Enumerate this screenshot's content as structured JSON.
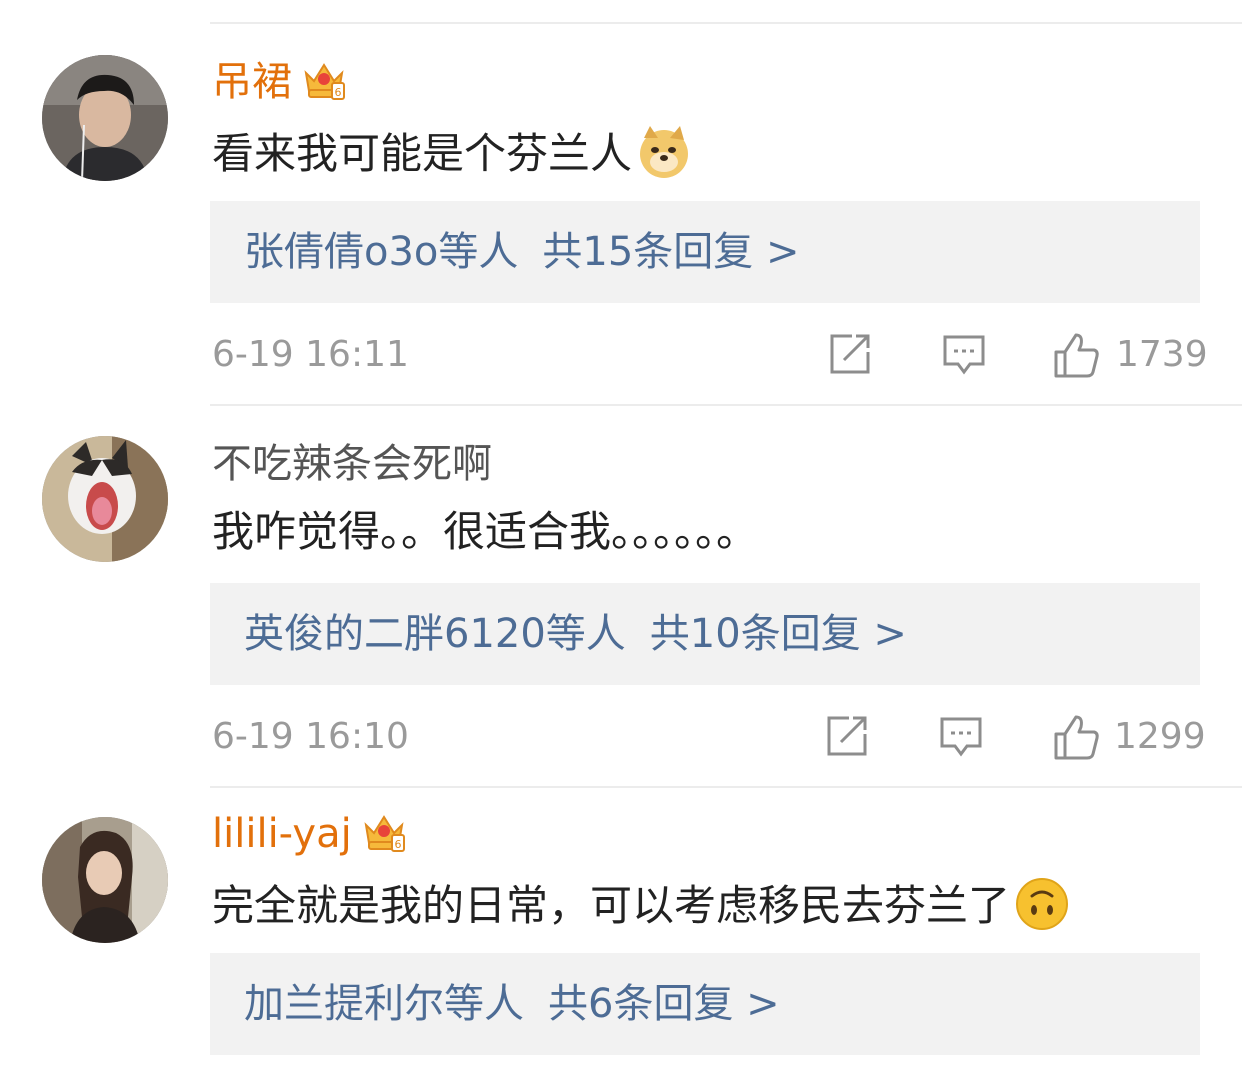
{
  "comments": [
    {
      "username": "吊裙",
      "content": "看来我可能是个芬兰人",
      "reply_names": "张倩倩o3o等人",
      "reply_count": "共15条回复 >",
      "time": "6-19 16:11",
      "likes": "1739"
    },
    {
      "username": "不吃辣条会死啊",
      "content": "我咋觉得。。很适合我。。。。。。",
      "reply_names": "英俊的二胖6120等人",
      "reply_count": "共10条回复 >",
      "time": "6-19 16:10",
      "likes": "1299"
    },
    {
      "username": "lilili-yaj",
      "content": "完全就是我的日常，可以考虑移民去芬兰了",
      "reply_names": "加兰提利尔等人",
      "reply_count": "共6条回复 >"
    }
  ],
  "colors": {
    "vip_name": "#e2700b",
    "reply_link": "#4d6c95",
    "meta_gray": "#9a9a9a"
  },
  "icons": [
    "crown-vip-icon",
    "doge-emoji-icon",
    "upside-down-smile-emoji-icon",
    "repost-icon",
    "comment-icon",
    "like-icon"
  ]
}
